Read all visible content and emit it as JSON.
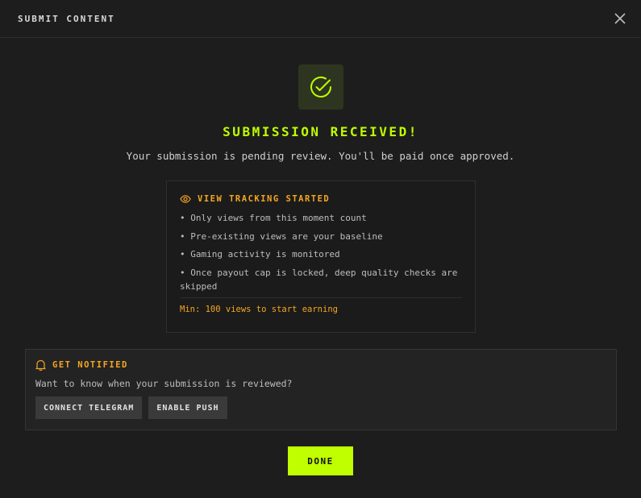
{
  "header": {
    "title": "SUBMIT CONTENT",
    "close_icon": "close-icon"
  },
  "status": {
    "icon": "check-circle-icon",
    "headline": "SUBMISSION RECEIVED!",
    "message": "Your submission is pending review. You'll be paid once approved."
  },
  "tracking": {
    "icon": "eye-icon",
    "title": "VIEW TRACKING STARTED",
    "items": [
      "• Only views from this moment count",
      "• Pre-existing views are your baseline",
      "• Gaming activity is monitored",
      "• Once payout cap is locked, deep quality checks are skipped"
    ],
    "min_note": "Min: 100 views to start earning"
  },
  "notify": {
    "icon": "bell-icon",
    "title": "GET NOTIFIED",
    "text": "Want to know when your submission is reviewed?",
    "telegram_label": "CONNECT TELEGRAM",
    "push_label": "ENABLE PUSH"
  },
  "footer": {
    "done_label": "DONE"
  },
  "colors": {
    "accent": "#bfff00",
    "warning": "#f5a623",
    "background": "#1d1d1d"
  }
}
